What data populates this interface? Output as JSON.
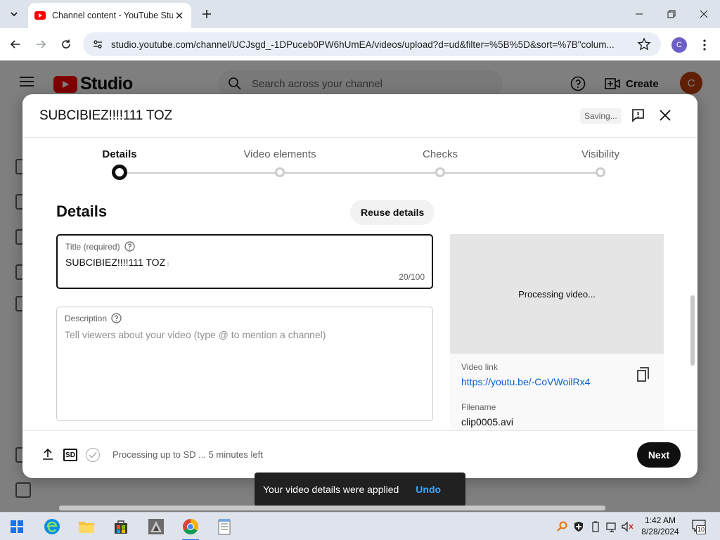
{
  "browser": {
    "tab": {
      "title": "Channel content - YouTube Studio"
    },
    "url": "studio.youtube.com/channel/UCJsgd_-1DPuceb0PW6hUmEA/videos/upload?d=ud&filter=%5B%5D&sort=%7B\"colum...",
    "profile_initial": "C"
  },
  "studio": {
    "logo_text": "Studio",
    "search_placeholder": "Search across your channel",
    "create_label": "Create",
    "avatar_initial": "C"
  },
  "modal": {
    "title": "SUBCIBIEZ!!!!111 TOZ",
    "saving_label": "Saving...",
    "steps": [
      {
        "label": "Details",
        "active": true
      },
      {
        "label": "Video elements",
        "active": false
      },
      {
        "label": "Checks",
        "active": false
      },
      {
        "label": "Visibility",
        "active": false
      }
    ],
    "section_title": "Details",
    "reuse_label": "Reuse details",
    "title_field": {
      "label": "Title (required)",
      "value": "SUBCIBIEZ!!!!111 TOZ",
      "counter": "20/100"
    },
    "description_field": {
      "label": "Description",
      "placeholder": "Tell viewers about your video (type @ to mention a channel)"
    },
    "preview": {
      "processing_text": "Processing video...",
      "video_link_label": "Video link",
      "video_link": "https://youtu.be/-CoVWoilRx4",
      "filename_label": "Filename",
      "filename": "clip0005.avi"
    },
    "footer": {
      "sd_badge": "SD",
      "status": "Processing up to SD ... 5 minutes left",
      "next_label": "Next"
    }
  },
  "toast": {
    "message": "Your video details were applied",
    "action": "Undo"
  },
  "taskbar": {
    "time": "1:42 AM",
    "date": "8/28/2024",
    "notification_count": "10"
  },
  "colors": {
    "youtube_red": "#ff0000",
    "link_blue": "#065fd4",
    "undo_blue": "#3ea6ff",
    "avatar": "#c2410c"
  }
}
